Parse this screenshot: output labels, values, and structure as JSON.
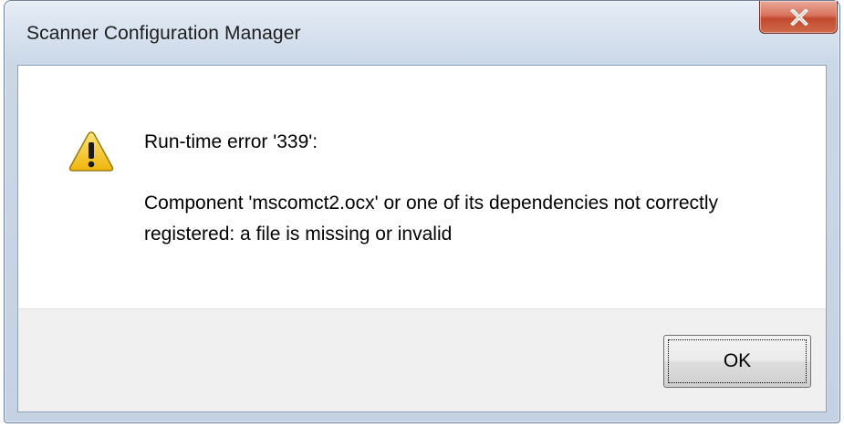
{
  "window": {
    "title": "Scanner Configuration Manager"
  },
  "message": {
    "icon": "warning-icon",
    "title": "Run-time error '339':",
    "body": "Component 'mscomct2.ocx' or one of its dependencies not correctly registered: a file is missing or invalid"
  },
  "buttons": {
    "ok_label": "OK"
  },
  "colors": {
    "close_button": "#c94a2f",
    "footer": "#f0f0f0",
    "warning_yellow": "#f4c51a"
  }
}
